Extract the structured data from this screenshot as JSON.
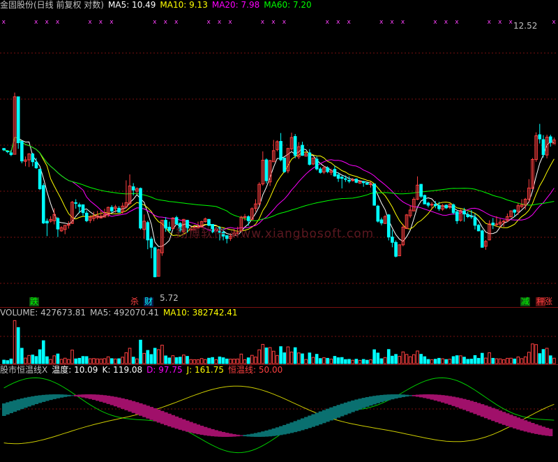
{
  "colors": {
    "up": "#ff4040",
    "down": "#00ffff",
    "ma5": "#ffffff",
    "ma10": "#ffff00",
    "ma20": "#ff00ff",
    "ma60": "#00ff00",
    "grid": "#7a1010",
    "text": "#c0c0c0"
  },
  "header": {
    "title": "金固股份(日线 前复权 对数)",
    "ma5": "MA5: 10.49",
    "ma10": "MA10: 9.13",
    "ma20": "MA20: 7.98",
    "ma60": "MA60: 7.20"
  },
  "watermark": "翔博软件 www.xiangbosoft.com",
  "annotations": {
    "high": "12.52",
    "low": "5.72",
    "signal_die": "跌",
    "signal_sha": "杀",
    "signal_cai": "财",
    "signal_jian": "减",
    "signal_cheng": "秤",
    "signal_zhang": "涨"
  },
  "volume_header": {
    "label": "VOLUME: 427673.81",
    "ma5": "MA5: 492070.41",
    "ma10": "MA10: 382742.41"
  },
  "indicator_header": {
    "name": "股市恒温线X",
    "temp": "温度: 10.09",
    "k": "K: 119.08",
    "d": "D: 97.75",
    "j": "J: 161.75",
    "hengwen": "恒温线: 50.00"
  },
  "chart_data": {
    "type": "candlestick",
    "title": "金固股份(日线 前复权 对数)",
    "price_range": [
      5.2,
      13.5
    ],
    "log_scale": true,
    "high_label": 12.52,
    "low_label": 5.72,
    "ohlc": [
      [
        8.65,
        8.61,
        8.66,
        8.58
      ],
      [
        8.58,
        8.57,
        8.59,
        8.52
      ],
      [
        8.53,
        8.48,
        8.61,
        8.44
      ],
      [
        8.49,
        10.21,
        10.35,
        8.49
      ],
      [
        10.21,
        8.81,
        10.21,
        8.64
      ],
      [
        8.85,
        8.31,
        8.87,
        8.25
      ],
      [
        8.3,
        8.34,
        8.43,
        8.17
      ],
      [
        8.34,
        8.5,
        8.52,
        8.15
      ],
      [
        8.5,
        8.29,
        8.53,
        8.17
      ],
      [
        8.28,
        8.13,
        8.39,
        8.1
      ],
      [
        8.09,
        7.6,
        8.11,
        7.57
      ],
      [
        7.68,
        6.81,
        7.74,
        6.79
      ],
      [
        6.85,
        6.81,
        6.91,
        6.53
      ],
      [
        6.85,
        6.89,
        6.96,
        6.82
      ],
      [
        6.86,
        7.0,
        7.14,
        6.78
      ],
      [
        6.91,
        6.68,
        6.94,
        6.51
      ],
      [
        6.64,
        6.71,
        6.74,
        6.62
      ],
      [
        6.67,
        6.76,
        6.77,
        6.57
      ],
      [
        6.76,
        6.78,
        6.85,
        6.69
      ],
      [
        6.8,
        7.28,
        7.31,
        6.79
      ],
      [
        7.27,
        7.26,
        7.35,
        7.13
      ],
      [
        7.22,
        7.18,
        7.27,
        7.03
      ],
      [
        7.22,
        7.04,
        7.23,
        6.97
      ],
      [
        7.03,
        6.86,
        7.09,
        6.83
      ],
      [
        6.87,
        6.94,
        6.98,
        6.81
      ],
      [
        6.91,
        6.96,
        7.06,
        6.85
      ],
      [
        6.93,
        6.97,
        7.08,
        6.89
      ],
      [
        6.92,
        6.96,
        7.09,
        6.91
      ],
      [
        6.94,
        7.0,
        7.13,
        6.94
      ],
      [
        6.99,
        7.16,
        7.18,
        6.94
      ],
      [
        7.16,
        7.08,
        7.21,
        7.04
      ],
      [
        7.13,
        7.17,
        7.22,
        7.04
      ],
      [
        7.14,
        7.05,
        7.19,
        7.04
      ],
      [
        7.06,
        7.19,
        7.27,
        7.02
      ],
      [
        7.17,
        7.27,
        7.81,
        7.14
      ],
      [
        7.25,
        7.67,
        7.96,
        7.22
      ],
      [
        7.65,
        7.57,
        7.74,
        7.44
      ],
      [
        7.54,
        7.6,
        7.64,
        7.47
      ],
      [
        7.61,
        6.7,
        7.63,
        6.67
      ],
      [
        6.67,
        6.85,
        7.0,
        6.47
      ],
      [
        6.82,
        6.45,
        6.86,
        6.26
      ],
      [
        6.47,
        6.3,
        6.52,
        6.08
      ],
      [
        6.29,
        5.73,
        6.32,
        5.72
      ],
      [
        5.74,
        6.25,
        6.27,
        5.74
      ],
      [
        6.19,
        6.87,
        6.88,
        6.13
      ],
      [
        6.87,
        6.7,
        6.94,
        6.62
      ],
      [
        6.72,
        6.65,
        6.84,
        6.6
      ],
      [
        6.69,
        6.92,
        6.94,
        6.66
      ],
      [
        6.93,
        6.79,
        6.97,
        6.77
      ],
      [
        6.8,
        6.65,
        6.83,
        6.6
      ],
      [
        6.62,
        6.89,
        6.9,
        6.6
      ],
      [
        6.87,
        6.7,
        6.88,
        6.6
      ],
      [
        6.68,
        6.68,
        6.74,
        6.57
      ],
      [
        6.66,
        6.72,
        6.75,
        6.65
      ],
      [
        6.72,
        6.72,
        6.84,
        6.68
      ],
      [
        6.72,
        6.84,
        6.86,
        6.72
      ],
      [
        6.84,
        6.9,
        6.93,
        6.82
      ],
      [
        6.89,
        6.76,
        6.9,
        6.74
      ],
      [
        6.78,
        6.62,
        6.78,
        6.59
      ],
      [
        6.64,
        6.68,
        6.73,
        6.61
      ],
      [
        6.71,
        6.61,
        6.74,
        6.44
      ],
      [
        6.61,
        6.53,
        6.69,
        6.44
      ],
      [
        6.54,
        6.48,
        6.54,
        6.38
      ],
      [
        6.48,
        6.53,
        6.59,
        6.43
      ],
      [
        6.55,
        6.59,
        6.68,
        6.51
      ],
      [
        6.59,
        6.6,
        6.73,
        6.52
      ],
      [
        6.64,
        6.94,
        6.97,
        6.62
      ],
      [
        6.94,
        6.95,
        7.01,
        6.86
      ],
      [
        6.95,
        6.86,
        6.98,
        6.75
      ],
      [
        6.89,
        7.13,
        7.16,
        6.86
      ],
      [
        7.14,
        7.24,
        7.35,
        7.06
      ],
      [
        7.24,
        7.71,
        7.76,
        7.21
      ],
      [
        7.72,
        8.33,
        8.57,
        7.68
      ],
      [
        8.34,
        7.8,
        8.38,
        7.73
      ],
      [
        7.77,
        8.32,
        8.34,
        7.67
      ],
      [
        8.29,
        8.59,
        8.89,
        8.29
      ],
      [
        8.62,
        8.84,
        8.88,
        8.57
      ],
      [
        8.85,
        8.34,
        9.09,
        8.3
      ],
      [
        8.39,
        8.03,
        8.4,
        8.0
      ],
      [
        8.05,
        8.65,
        8.67,
        7.99
      ],
      [
        8.64,
        8.96,
        9.1,
        8.59
      ],
      [
        8.99,
        8.46,
        9.06,
        8.38
      ],
      [
        8.42,
        8.7,
        8.83,
        8.36
      ],
      [
        8.74,
        8.46,
        8.84,
        8.45
      ],
      [
        8.44,
        8.5,
        8.55,
        8.43
      ],
      [
        8.53,
        8.22,
        8.63,
        8.19
      ],
      [
        8.23,
        8.39,
        8.4,
        8.2
      ],
      [
        8.36,
        8.1,
        8.43,
        8.06
      ],
      [
        8.1,
        8.01,
        8.15,
        7.98
      ],
      [
        8.02,
        8.13,
        8.19,
        7.97
      ],
      [
        8.13,
        8.03,
        8.17,
        7.99
      ],
      [
        8.01,
        8.05,
        8.11,
        7.94
      ],
      [
        8.09,
        7.92,
        8.18,
        7.9
      ],
      [
        7.95,
        7.86,
        8.01,
        7.77
      ],
      [
        7.89,
        7.86,
        7.93,
        7.61
      ],
      [
        7.85,
        7.84,
        7.93,
        7.77
      ],
      [
        7.81,
        7.79,
        7.91,
        7.74
      ],
      [
        7.8,
        7.82,
        7.87,
        7.78
      ],
      [
        7.84,
        7.76,
        7.86,
        7.74
      ],
      [
        7.74,
        7.78,
        7.78,
        7.72
      ],
      [
        7.78,
        7.75,
        7.8,
        7.65
      ],
      [
        7.74,
        7.71,
        7.78,
        7.7
      ],
      [
        7.72,
        7.72,
        7.78,
        7.63
      ],
      [
        7.72,
        7.21,
        7.72,
        7.2
      ],
      [
        7.19,
        6.85,
        7.22,
        6.82
      ],
      [
        6.88,
        6.81,
        6.93,
        6.76
      ],
      [
        6.8,
        6.95,
        6.99,
        6.79
      ],
      [
        6.99,
        6.51,
        7.01,
        6.44
      ],
      [
        6.51,
        6.4,
        6.66,
        6.3
      ],
      [
        6.4,
        6.12,
        6.44,
        6.1
      ],
      [
        6.13,
        6.35,
        6.36,
        6.13
      ],
      [
        6.35,
        6.72,
        6.79,
        6.32
      ],
      [
        6.69,
        6.99,
        7.01,
        6.69
      ],
      [
        6.97,
        7.1,
        7.21,
        6.92
      ],
      [
        7.08,
        7.35,
        7.4,
        7.07
      ],
      [
        7.35,
        7.69,
        7.91,
        7.33
      ],
      [
        7.71,
        7.42,
        7.72,
        7.38
      ],
      [
        7.44,
        7.24,
        7.46,
        7.24
      ],
      [
        7.26,
        7.21,
        7.29,
        7.16
      ],
      [
        7.22,
        7.23,
        7.28,
        7.13
      ],
      [
        7.23,
        7.2,
        7.31,
        7.14
      ],
      [
        7.2,
        7.13,
        7.29,
        7.08
      ],
      [
        7.12,
        7.2,
        7.24,
        7.08
      ],
      [
        7.21,
        7.15,
        7.23,
        7.12
      ],
      [
        7.16,
        7.23,
        7.25,
        7.12
      ],
      [
        7.22,
        7.04,
        7.25,
        7.0
      ],
      [
        7.06,
        6.86,
        7.1,
        6.79
      ],
      [
        6.87,
        7.09,
        7.12,
        6.84
      ],
      [
        7.08,
        7.01,
        7.15,
        6.84
      ],
      [
        7.0,
        6.95,
        7.06,
        6.92
      ],
      [
        6.96,
        6.95,
        7.1,
        6.9
      ],
      [
        6.93,
        6.76,
        7.02,
        6.67
      ],
      [
        6.76,
        6.64,
        6.79,
        6.63
      ],
      [
        6.64,
        6.3,
        6.67,
        6.29
      ],
      [
        6.32,
        6.42,
        6.45,
        6.25
      ],
      [
        6.45,
        6.79,
        6.87,
        6.44
      ],
      [
        6.81,
        6.77,
        6.92,
        6.68
      ],
      [
        6.78,
        6.79,
        6.96,
        6.73
      ],
      [
        6.79,
        6.83,
        6.9,
        6.71
      ],
      [
        6.84,
        6.85,
        6.88,
        6.73
      ],
      [
        6.86,
        6.95,
        7.02,
        6.83
      ],
      [
        6.95,
        7.08,
        7.09,
        6.93
      ],
      [
        7.1,
        7.05,
        7.12,
        6.95
      ],
      [
        7.07,
        7.2,
        7.26,
        6.99
      ],
      [
        7.18,
        7.22,
        7.35,
        7.14
      ],
      [
        7.21,
        7.35,
        7.38,
        7.11
      ],
      [
        7.35,
        7.62,
        7.84,
        7.3
      ],
      [
        7.61,
        8.35,
        8.39,
        7.59
      ],
      [
        8.35,
        9.01,
        9.11,
        8.29
      ],
      [
        9.04,
        8.92,
        9.36,
        8.79
      ],
      [
        8.9,
        8.48,
        9.03,
        8.4
      ],
      [
        8.47,
        8.97,
        9.04,
        8.38
      ],
      [
        8.98,
        8.82,
        9.04,
        8.7
      ],
      [
        8.78,
        8.89,
        8.96,
        8.78
      ]
    ],
    "ma_lines": [
      {
        "name": "MA5",
        "value": 10.49
      },
      {
        "name": "MA10",
        "value": 9.13
      },
      {
        "name": "MA20",
        "value": 7.98
      },
      {
        "name": "MA60",
        "value": 7.2
      }
    ],
    "volume": {
      "value": 427673.81,
      "ma5": 492070.41,
      "ma10": 382742.41
    },
    "indicator": {
      "name": "股市恒温线X",
      "temperature": 10.09,
      "K": 119.08,
      "D": 97.75,
      "J": 161.75,
      "hengwen": 50.0
    }
  }
}
